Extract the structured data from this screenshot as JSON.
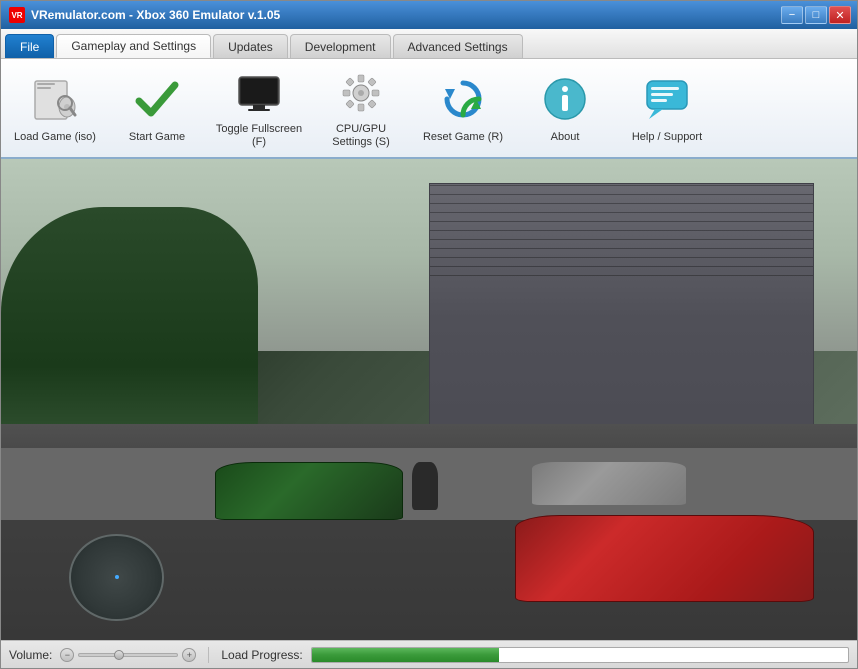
{
  "window": {
    "title": "VRemulator.com - Xbox 360 Emulator v.1.05",
    "icon_label": "VR"
  },
  "titlebar": {
    "minimize": "−",
    "maximize": "□",
    "close": "✕"
  },
  "tabs": [
    {
      "id": "file",
      "label": "File",
      "active": false
    },
    {
      "id": "gameplay",
      "label": "Gameplay and Settings",
      "active": true
    },
    {
      "id": "updates",
      "label": "Updates",
      "active": false
    },
    {
      "id": "development",
      "label": "Development",
      "active": false
    },
    {
      "id": "advanced",
      "label": "Advanced Settings",
      "active": false
    }
  ],
  "toolbar": {
    "buttons": [
      {
        "id": "load-game",
        "label": "Load Game (iso)",
        "icon": "load-game-icon"
      },
      {
        "id": "start-game",
        "label": "Start Game",
        "icon": "start-game-icon"
      },
      {
        "id": "toggle-fullscreen",
        "label": "Toggle Fullscreen (F)",
        "icon": "fullscreen-icon"
      },
      {
        "id": "cpu-gpu-settings",
        "label": "CPU/GPU Settings (S)",
        "icon": "settings-icon"
      },
      {
        "id": "reset-game",
        "label": "Reset Game (R)",
        "icon": "reset-icon"
      },
      {
        "id": "about",
        "label": "About",
        "icon": "about-icon"
      },
      {
        "id": "help-support",
        "label": "Help / Support",
        "icon": "help-icon"
      }
    ]
  },
  "statusbar": {
    "volume_label": "Volume:",
    "load_label": "Load Progress:",
    "volume_min": "−",
    "volume_max": "+",
    "progress_percent": 35
  }
}
